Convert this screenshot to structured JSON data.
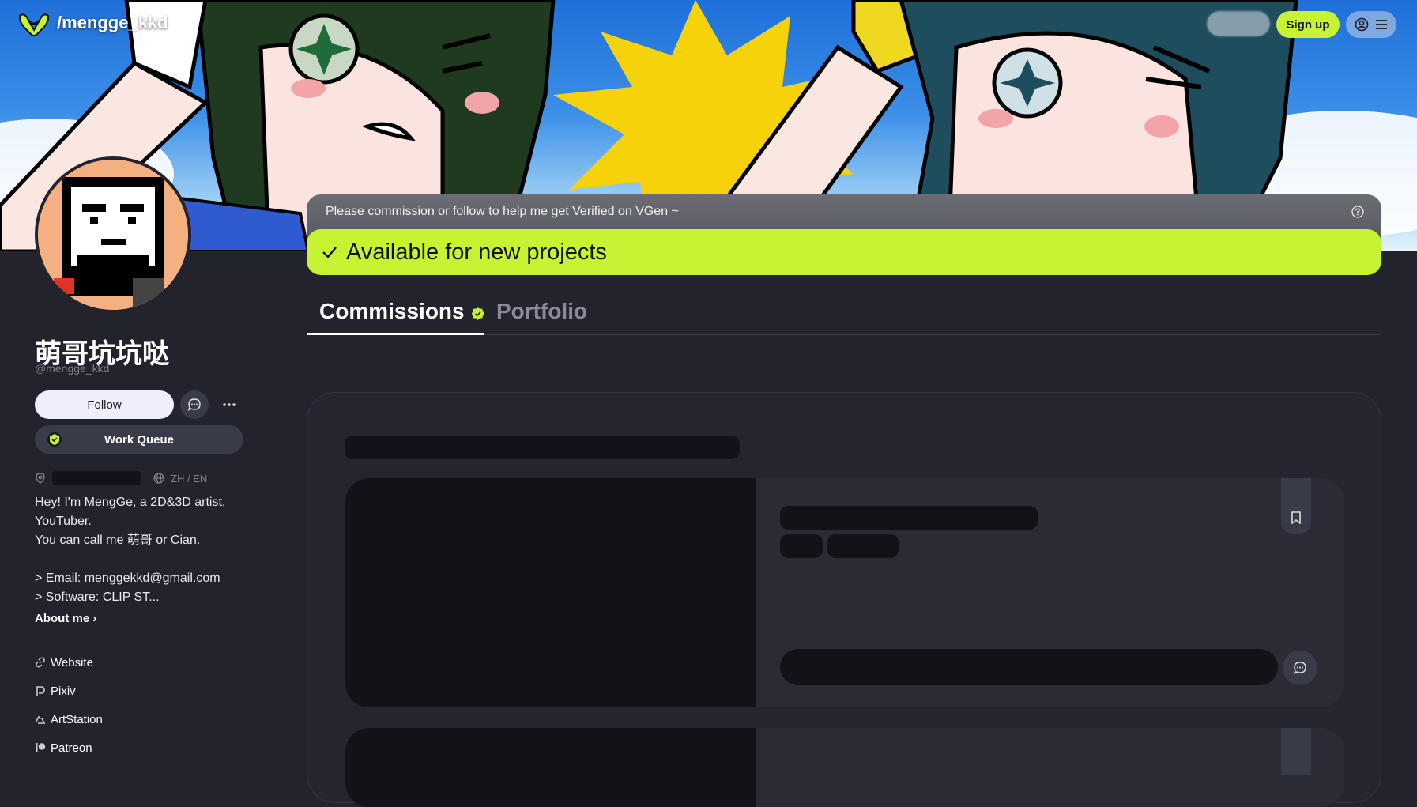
{
  "nav": {
    "handle_title": "/mengge_kkd",
    "signup_label": "Sign up"
  },
  "profile": {
    "display_name": "萌哥坑坑哒",
    "handle": "@mengge_kkd",
    "follow_label": "Follow",
    "work_queue_label": "Work Queue",
    "languages": "ZH / EN",
    "bio": "Hey! I'm MengGe, a 2D&3D artist, YouTuber.\nYou can call me 萌哥 or Cian.\n\n> Email: menggekkd@gmail.com\n> Software: CLIP ST...",
    "about_me_label": "About me ›",
    "links": [
      {
        "label": "Website",
        "icon": "link-icon"
      },
      {
        "label": "Pixiv",
        "icon": "pixiv-icon"
      },
      {
        "label": "ArtStation",
        "icon": "artstation-icon"
      },
      {
        "label": "Patreon",
        "icon": "patreon-icon"
      }
    ]
  },
  "status": {
    "message": "Please commission or follow to help me get Verified on VGen ~",
    "availability": "Available for new projects"
  },
  "tabs": [
    {
      "label": "Commissions",
      "active": true
    },
    {
      "label": "Portfolio",
      "active": false
    }
  ],
  "colors": {
    "accent": "#c6f432",
    "background": "#23232e",
    "panel": "#252530",
    "skeleton": "#121219"
  }
}
